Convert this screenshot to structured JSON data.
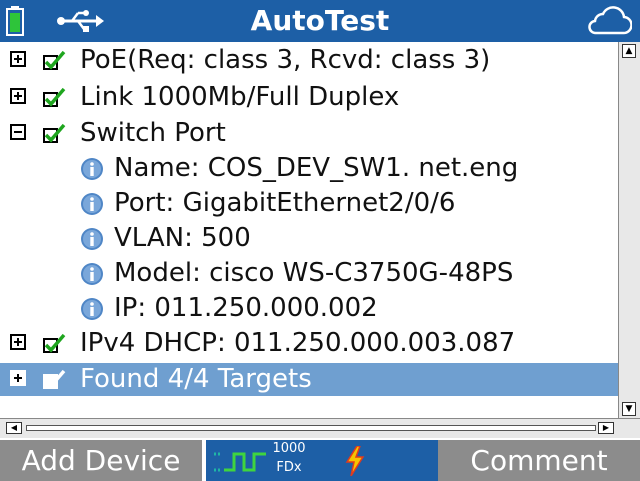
{
  "header": {
    "title": "AutoTest",
    "icons": [
      "battery-icon",
      "usb-icon",
      "cloud-icon"
    ]
  },
  "tree": {
    "items": [
      {
        "label": "PoE(Req: class 3, Rcvd: class 3)",
        "expander": "plus",
        "status": "check"
      },
      {
        "label": "Link 1000Mb/Full Duplex",
        "expander": "plus",
        "status": "check"
      },
      {
        "label": "Switch Port",
        "expander": "minus",
        "status": "check",
        "children": [
          {
            "label": "Name: COS_DEV_SW1. net.eng"
          },
          {
            "label": "Port: GigabitEthernet2/0/6"
          },
          {
            "label": "VLAN: 500"
          },
          {
            "label": "Model: cisco WS-C3750G-48PS"
          },
          {
            "label": "IP:  011.250.000.002"
          }
        ]
      },
      {
        "label": "IPv4 DHCP:  011.250.000.003.087",
        "expander": "plus",
        "status": "check"
      },
      {
        "label": "Found 4/4 Targets",
        "expander": "plus",
        "status": "check",
        "selected": true
      }
    ]
  },
  "footer": {
    "left_button": "Add Device",
    "right_button": "Comment",
    "link_speed": "1000",
    "link_duplex": "FDx"
  },
  "colors": {
    "accent": "#1d5fa6",
    "selection": "#6f9fd0",
    "check": "#1fa61f",
    "button": "#8c8c8c",
    "info": "#4f86c6",
    "power": "#f5c400"
  }
}
